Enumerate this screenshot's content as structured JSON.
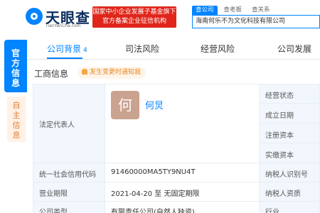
{
  "header": {
    "logo_text": "天眼查",
    "logo_sub": "TianYanCha.com",
    "badge_line1": "国家中小企业发展子基金旗下",
    "badge_line2": "官方备案企业征信机构",
    "search_tabs": [
      "查公司",
      "查老板",
      "查关系"
    ],
    "search_value": "海南何乐不为文化科技有限公司"
  },
  "side_tabs": {
    "active": [
      "官",
      "方",
      "信",
      "息"
    ],
    "inactive": [
      "自",
      "主",
      "信",
      "息"
    ]
  },
  "tabs": [
    {
      "label": "公司背景",
      "count": "4"
    },
    {
      "label": "司法风险"
    },
    {
      "label": "经营风险"
    },
    {
      "label": "公司发展"
    }
  ],
  "section": {
    "title": "工商信息",
    "notice": "发生变更时通知我"
  },
  "table": {
    "legal_rep_label": "法定代表人",
    "avatar_char": "何",
    "legal_rep_name": "何炅",
    "right_labels": [
      "经营状态",
      "成立日期",
      "注册资本",
      "实缴资本",
      "纳税人识别号",
      "纳税人资质",
      "行业"
    ],
    "rows": [
      {
        "label": "统一社会信用代码",
        "value": "91460000MA5TY9NU4T"
      },
      {
        "label": "营业期限",
        "value": "2021-04-20 至 无固定期限"
      },
      {
        "label": "公司类型",
        "value": "有限责任公司(自然人独资)"
      }
    ]
  },
  "colors": {
    "accent": "#0084ff",
    "badge": "#e0261a",
    "notice": "#e48a2b"
  }
}
